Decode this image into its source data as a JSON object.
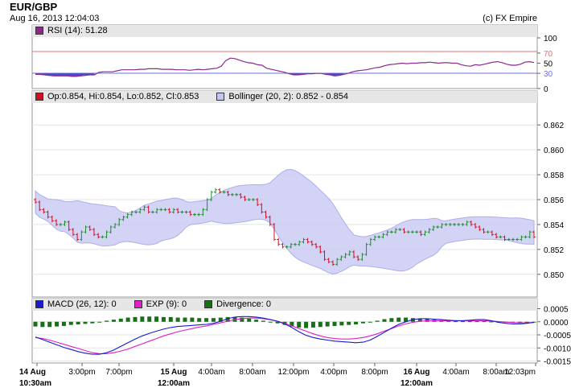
{
  "header": {
    "title": "EUR/GBP",
    "timestamp": "Aug 16, 2013 12:04:03",
    "copyright": "(c) FX Empire"
  },
  "legends": {
    "rsi": "RSI (14): 51.28",
    "ohlc": "Op:0.854, Hi:0.854, Lo:0.852, Cl:0.853",
    "bollinger": "Bollinger (20, 2): 0.852 - 0.854",
    "macd": "MACD (26, 12): 0",
    "exp": "EXP (9): 0",
    "divergence": "Divergence: 0"
  },
  "colors": {
    "up_candle": "#1e8c2e",
    "down_candle": "#d01020",
    "bollinger_fill": "#ccccf5",
    "bollinger_line": "#a0a0e8",
    "rsi_line": "#8b2a8b",
    "rsi_fill": "#4a4ad8",
    "overbought": "#e07070",
    "oversold": "#7070e0",
    "macd_line": "#1a1ad0",
    "exp_line": "#e020c8",
    "divergence_bar": "#1a6e1a",
    "panel_bg": "#e6e6e6"
  },
  "chart_data": [
    {
      "type": "line",
      "name": "RSI",
      "ylim": [
        0,
        100
      ],
      "y_ticks": [
        "100",
        "70",
        "50",
        "30",
        "0"
      ],
      "levels": [
        70,
        30
      ],
      "values": [
        28,
        28,
        27,
        26,
        25,
        25,
        25,
        25,
        24,
        24,
        25,
        26,
        27,
        27,
        32,
        33,
        33,
        33,
        35,
        37,
        37,
        37,
        37,
        38,
        38,
        39,
        39,
        39,
        38,
        38,
        38,
        37,
        37,
        37,
        36,
        37,
        38,
        37,
        38,
        39,
        40,
        44,
        55,
        60,
        59,
        56,
        53,
        51,
        50,
        47,
        46,
        40,
        38,
        36,
        34,
        32,
        29,
        27,
        27,
        28,
        29,
        29,
        30,
        30,
        28,
        27,
        25,
        26,
        28,
        30,
        33,
        35,
        36,
        37,
        39,
        41,
        42,
        45,
        47,
        48,
        49,
        50,
        49,
        50,
        50,
        51,
        51,
        52,
        51,
        50,
        51,
        51,
        50,
        50,
        47,
        45,
        44,
        47,
        46,
        48,
        50,
        52,
        53,
        51,
        48,
        46,
        46,
        48,
        52,
        53,
        51.28
      ]
    },
    {
      "type": "candlestick",
      "name": "EUR/GBP",
      "ylim": [
        0.8485,
        0.8635
      ],
      "y_ticks": [
        "0.862",
        "0.860",
        "0.858",
        "0.856",
        "0.854",
        "0.852",
        "0.850"
      ],
      "close": [
        0.8558,
        0.8552,
        0.855,
        0.8546,
        0.8543,
        0.854,
        0.854,
        0.8542,
        0.8536,
        0.8532,
        0.8528,
        0.8534,
        0.8538,
        0.8536,
        0.8532,
        0.853,
        0.853,
        0.8534,
        0.8538,
        0.854,
        0.8544,
        0.8546,
        0.8548,
        0.855,
        0.855,
        0.8552,
        0.8554,
        0.855,
        0.855,
        0.8552,
        0.8552,
        0.8552,
        0.855,
        0.8552,
        0.855,
        0.855,
        0.855,
        0.8548,
        0.8548,
        0.8548,
        0.8552,
        0.856,
        0.8566,
        0.8568,
        0.8566,
        0.8566,
        0.8564,
        0.8564,
        0.8564,
        0.8562,
        0.856,
        0.856,
        0.856,
        0.8556,
        0.855,
        0.8546,
        0.854,
        0.8528,
        0.8524,
        0.8522,
        0.8522,
        0.8524,
        0.8524,
        0.8526,
        0.8528,
        0.8526,
        0.8524,
        0.8522,
        0.8518,
        0.8512,
        0.851,
        0.8508,
        0.8512,
        0.8514,
        0.8516,
        0.8518,
        0.8514,
        0.8512,
        0.8516,
        0.8524,
        0.8528,
        0.853,
        0.853,
        0.8532,
        0.8534,
        0.8534,
        0.8536,
        0.8536,
        0.8534,
        0.8534,
        0.8534,
        0.8534,
        0.8532,
        0.8534,
        0.8536,
        0.8538,
        0.8538,
        0.854,
        0.854,
        0.854,
        0.854,
        0.854,
        0.854,
        0.8542,
        0.854,
        0.8538,
        0.8536,
        0.8534,
        0.8534,
        0.8532,
        0.853,
        0.853,
        0.8528,
        0.8528,
        0.8528,
        0.8528,
        0.853,
        0.853,
        0.8534,
        0.853
      ]
    },
    {
      "type": "line",
      "name": "MACD",
      "ylim": [
        -0.0017,
        0.0007
      ],
      "y_ticks": [
        "0.0005",
        "0.0000",
        "-0.0005",
        "-0.0010",
        "-0.0015"
      ],
      "x_ticks": [
        "14 Aug\n10:30am",
        "3:00pm",
        "7:00pm",
        "15 Aug\n12:00am",
        "4:00am",
        "8:00am",
        "12:00pm",
        "4:00pm",
        "8:00pm",
        "16 Aug\n12:00am",
        "4:00am",
        "8:00am",
        "12:03pm"
      ],
      "macd": [
        -0.00058,
        -0.00068,
        -0.00078,
        -0.00088,
        -0.00098,
        -0.00106,
        -0.00114,
        -0.0012,
        -0.00124,
        -0.00124,
        -0.00118,
        -0.00108,
        -0.00094,
        -0.0008,
        -0.00066,
        -0.00054,
        -0.00044,
        -0.00036,
        -0.00028,
        -0.00022,
        -0.00018,
        -0.00016,
        -0.00014,
        -0.00012,
        -0.0001,
        -6e-05,
        2e-05,
        0.00012,
        0.00018,
        0.0002,
        0.0002,
        0.00018,
        0.00014,
        8e-05,
        2e-05,
        -8e-05,
        -0.00022,
        -0.00038,
        -0.00052,
        -0.0006,
        -0.00066,
        -0.0007,
        -0.00074,
        -0.00076,
        -0.00078,
        -0.0008,
        -0.00078,
        -0.0007,
        -0.00056,
        -0.0004,
        -0.00024,
        -0.0001,
        0.0,
        8e-05,
        0.00012,
        0.00012,
        0.0001,
        8e-05,
        6e-05,
        4e-05,
        4e-05,
        6e-05,
        8e-05,
        8e-05,
        4e-05,
        -2e-05,
        -6e-05,
        -8e-05,
        -8e-05,
        -6e-05,
        -2e-05
      ],
      "exp": [
        -0.0006,
        -0.00064,
        -0.0007,
        -0.00078,
        -0.00086,
        -0.00094,
        -0.00102,
        -0.0011,
        -0.00118,
        -0.00122,
        -0.00122,
        -0.00118,
        -0.00112,
        -0.00104,
        -0.00094,
        -0.00084,
        -0.00074,
        -0.00064,
        -0.00054,
        -0.00046,
        -0.00038,
        -0.00032,
        -0.00026,
        -0.0002,
        -0.00016,
        -0.0001,
        -4e-05,
        2e-05,
        8e-05,
        0.00012,
        0.00014,
        0.00014,
        0.00012,
        8e-05,
        2e-05,
        -6e-05,
        -0.00016,
        -0.00026,
        -0.00036,
        -0.00046,
        -0.00054,
        -0.0006,
        -0.00064,
        -0.00066,
        -0.00066,
        -0.00064,
        -0.0006,
        -0.00054,
        -0.00046,
        -0.00036,
        -0.00026,
        -0.00016,
        -8e-05,
        -2e-05,
        2e-05,
        4e-05,
        4e-05,
        4e-05,
        4e-05,
        4e-05,
        4e-05,
        4e-05,
        4e-05,
        4e-05,
        3e-05,
        1e-05,
        -1e-05,
        -3e-05,
        -4e-05,
        -4e-05,
        -3e-05
      ],
      "divergence": [
        -0.00018,
        -0.0002,
        -0.0002,
        -0.00018,
        -0.00016,
        -0.00012,
        -0.0001,
        -8e-05,
        -6e-05,
        -2e-05,
        4e-05,
        8e-05,
        0.00012,
        0.00016,
        0.00018,
        0.0002,
        0.0002,
        0.0002,
        0.00018,
        0.00018,
        0.00016,
        0.00016,
        0.00016,
        0.00014,
        0.00014,
        0.00014,
        0.00016,
        0.00018,
        0.00018,
        0.00016,
        0.00012,
        8e-05,
        4e-05,
        0.0,
        -6e-05,
        -0.00012,
        -0.00018,
        -0.00022,
        -0.00024,
        -0.00022,
        -0.0002,
        -0.00018,
        -0.00016,
        -0.00014,
        -0.00012,
        -0.0001,
        -6e-05,
        -2e-05,
        4e-05,
        0.0001,
        0.00014,
        0.00016,
        0.00016,
        0.00014,
        0.00012,
        0.0001,
        8e-05,
        6e-05,
        4e-05,
        2e-05,
        2e-05,
        2e-05,
        2e-05,
        2e-05,
        1e-05,
        0.0,
        -2e-05,
        -4e-05,
        -5e-05,
        -4e-05,
        -2e-05
      ]
    }
  ]
}
